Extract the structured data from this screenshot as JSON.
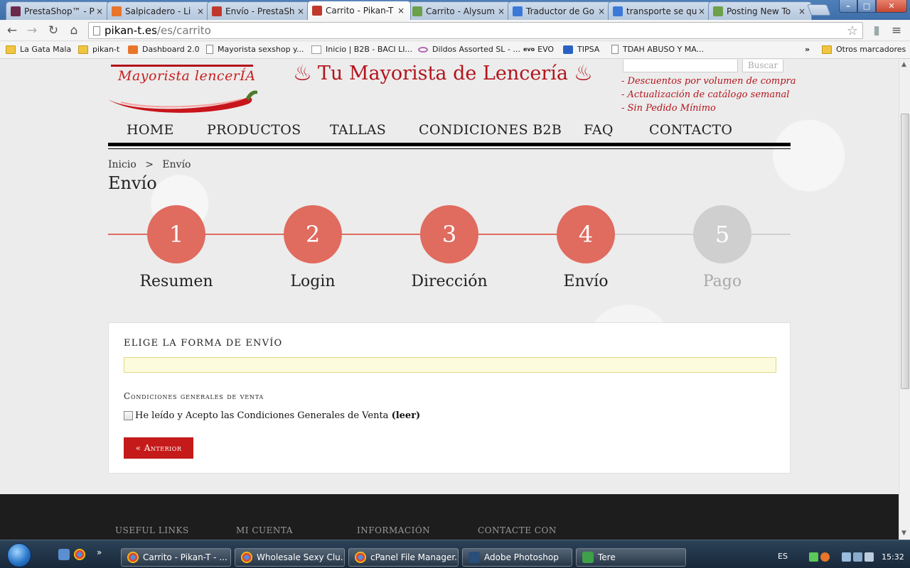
{
  "browser": {
    "tabs": [
      {
        "label": "PrestaShop™ - P",
        "close": "×",
        "favicon_color": "#6b2a4a"
      },
      {
        "label": "Salpicadero - Li",
        "close": "×",
        "favicon_color": "#e8752a"
      },
      {
        "label": "Envío - PrestaSh",
        "close": "×",
        "favicon_color": "#c0392b"
      },
      {
        "label": "Carrito - Pikan-T",
        "close": "×",
        "favicon_color": "#c0392b",
        "active": true
      },
      {
        "label": "Carrito - Alysum",
        "close": "×",
        "favicon_color": "#6ca04a"
      },
      {
        "label": "Traductor de Go",
        "close": "×",
        "favicon_color": "#3b78d8"
      },
      {
        "label": "transporte se qu",
        "close": "×",
        "favicon_color": "#3b78d8"
      },
      {
        "label": "Posting New To",
        "close": "×",
        "favicon_color": "#6ca04a"
      }
    ],
    "url_host": "pikan-t.es",
    "url_path": "/es/carrito",
    "window_controls": {
      "minimize": "–",
      "maximize": "□",
      "close": "✕"
    }
  },
  "bookmarks": {
    "items": [
      {
        "label": "La Gata Mala",
        "icon": "folder-icon"
      },
      {
        "label": "pikan-t",
        "icon": "folder-icon"
      },
      {
        "label": "Dashboard 2.0",
        "icon": "dashboard-icon"
      },
      {
        "label": "Mayorista sexshop y...",
        "icon": "page-icon"
      },
      {
        "label": "Inicio | B2B - BACI LI...",
        "icon": "baci-icon"
      },
      {
        "label": "Dildos Assorted SL - ...",
        "icon": "dildos-icon"
      },
      {
        "label": "EVO",
        "icon": "evo-icon"
      },
      {
        "label": "TIPSA",
        "icon": "tipsa-icon"
      },
      {
        "label": "TDAH ABUSO Y MA...",
        "icon": "page-icon"
      }
    ],
    "overflow": "»",
    "other": "Otros marcadores"
  },
  "site": {
    "logo_text": "Mayorista lencerÍA",
    "slogan": "Tu Mayorista de Lencería",
    "search_button": "Buscar",
    "benefits": [
      "- Descuentos por volumen de compra",
      "- Actualización de catálogo semanal",
      "- Sin Pedido Mínimo"
    ],
    "nav": [
      "HOME",
      "PRODUCTOS",
      "TALLAS",
      "CONDICIONES B2B",
      "FAQ",
      "CONTACTO"
    ],
    "breadcrumb": {
      "home": "Inicio",
      "separator": ">",
      "current": "Envío"
    },
    "page_title": "Envío",
    "steps": [
      {
        "number": "1",
        "label": "Resumen",
        "state": "done"
      },
      {
        "number": "2",
        "label": "Login",
        "state": "done"
      },
      {
        "number": "3",
        "label": "Dirección",
        "state": "done"
      },
      {
        "number": "4",
        "label": "Envío",
        "state": "current"
      },
      {
        "number": "5",
        "label": "Pago",
        "state": "pending"
      }
    ],
    "step_colors": {
      "active": "#e06b5f",
      "pending": "#cfcfcf",
      "active_text": "#222222",
      "pending_text": "#a8a8a8"
    },
    "panel": {
      "title": "ELIGE LA FORMA DE ENVÍO",
      "terms_title": "Condiciones generales de venta",
      "terms_label": "He leído y Acepto las Condiciones Generales de Venta",
      "terms_link": "(leer)",
      "prev_button": "« Anterior"
    },
    "footer": {
      "columns": [
        "USEFUL LINKS",
        "MI CUENTA",
        "INFORMACIÓN",
        "CONTACTE CON NOSOTROS"
      ]
    }
  },
  "taskbar": {
    "buttons": [
      {
        "label": "Carrito - Pikan-T - ...",
        "icon": "chrome-icon"
      },
      {
        "label": "Wholesale Sexy Clu...",
        "icon": "chrome-icon"
      },
      {
        "label": "cPanel File Manager...",
        "icon": "chrome-icon"
      },
      {
        "label": "Adobe Photoshop",
        "icon": "photoshop-icon"
      },
      {
        "label": "Tere",
        "icon": "user-icon"
      }
    ],
    "language": "ES",
    "time": "15:32",
    "overflow": "»"
  }
}
